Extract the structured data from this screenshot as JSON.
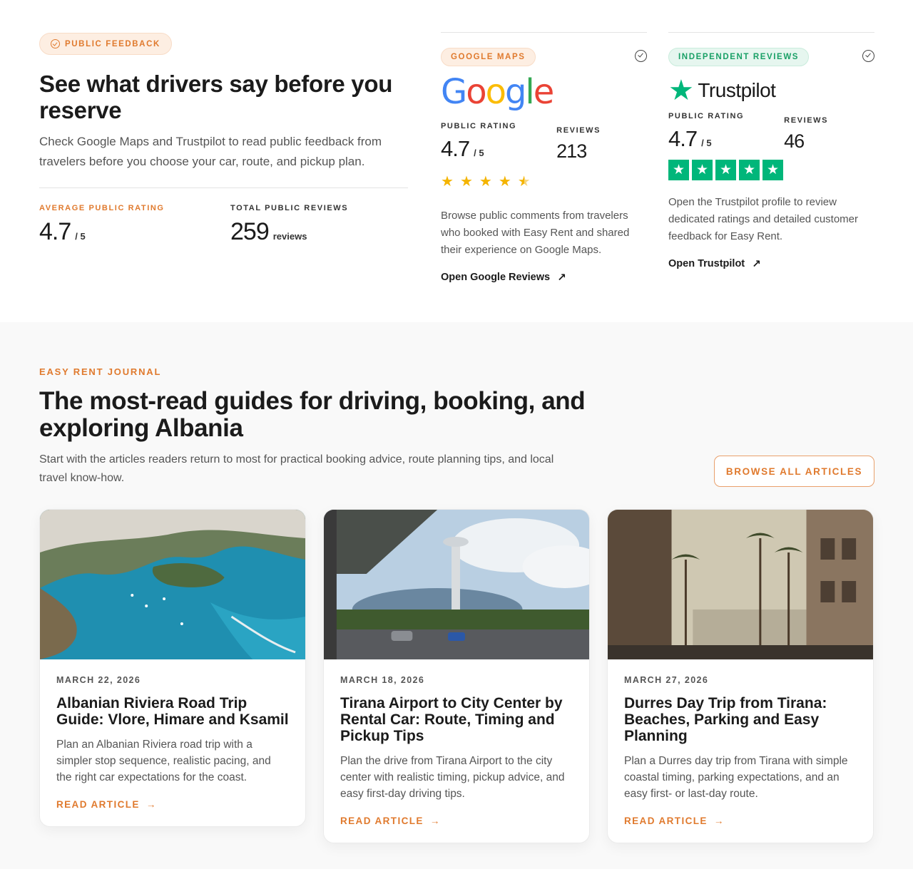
{
  "hero": {
    "badge": "PUBLIC FEEDBACK",
    "title": "See what drivers say before you reserve",
    "description": "Check Google Maps and Trustpilot to read public feedback from travelers before you choose your car, route, and pickup plan.",
    "avg_label": "AVERAGE PUBLIC RATING",
    "avg_value": "4.7",
    "avg_suffix": "/ 5",
    "total_label": "TOTAL PUBLIC REVIEWS",
    "total_value": "259",
    "total_suffix": "reviews"
  },
  "google": {
    "badge": "GOOGLE MAPS",
    "logo_text": "Google",
    "rating_label": "PUBLIC RATING",
    "rating_value": "4.7",
    "rating_suffix": "/ 5",
    "reviews_label": "REVIEWS",
    "reviews_value": "213",
    "stars": 4.5,
    "description": "Browse public comments from travelers who booked with Easy Rent and shared their experience on Google Maps.",
    "link": "Open Google Reviews"
  },
  "trustpilot": {
    "badge": "INDEPENDENT REVIEWS",
    "logo_text": "Trustpilot",
    "rating_label": "PUBLIC RATING",
    "rating_value": "4.7",
    "rating_suffix": "/ 5",
    "reviews_label": "REVIEWS",
    "reviews_value": "46",
    "stars": 5,
    "description": "Open the Trustpilot profile to review dedicated ratings and detailed customer feedback for Easy Rent.",
    "link": "Open Trustpilot"
  },
  "journal": {
    "tag": "EASY RENT JOURNAL",
    "title": "The most-read guides for driving, booking, and exploring Albania",
    "description": "Start with the articles readers return to most for practical booking advice, route planning tips, and local travel know-how.",
    "browse_label": "BROWSE ALL ARTICLES",
    "articles": [
      {
        "date": "MARCH 22, 2026",
        "title": "Albanian Riviera Road Trip Guide: Vlore, Himare and Ksamil",
        "description": "Plan an Albanian Riviera road trip with a simpler stop sequence, realistic pacing, and the right car expectations for the coast.",
        "link": "READ ARTICLE"
      },
      {
        "date": "MARCH 18, 2026",
        "title": "Tirana Airport to City Center by Rental Car: Route, Timing and Pickup Tips",
        "description": "Plan the drive from Tirana Airport to the city center with realistic timing, pickup advice, and easy first-day driving tips.",
        "link": "READ ARTICLE"
      },
      {
        "date": "MARCH 27, 2026",
        "title": "Durres Day Trip from Tirana: Beaches, Parking and Easy Planning",
        "description": "Plan a Durres day trip from Tirana with simple coastal timing, parking expectations, and an easy first- or last-day route.",
        "link": "READ ARTICLE"
      }
    ]
  },
  "colors": {
    "accent": "#e07a2e",
    "trustpilot_green": "#00b67a",
    "google_star": "#f4b400"
  },
  "icons": [
    "check-circle-icon",
    "verified-icon",
    "arrow-up-right-icon",
    "arrow-right-icon",
    "star-icon"
  ]
}
